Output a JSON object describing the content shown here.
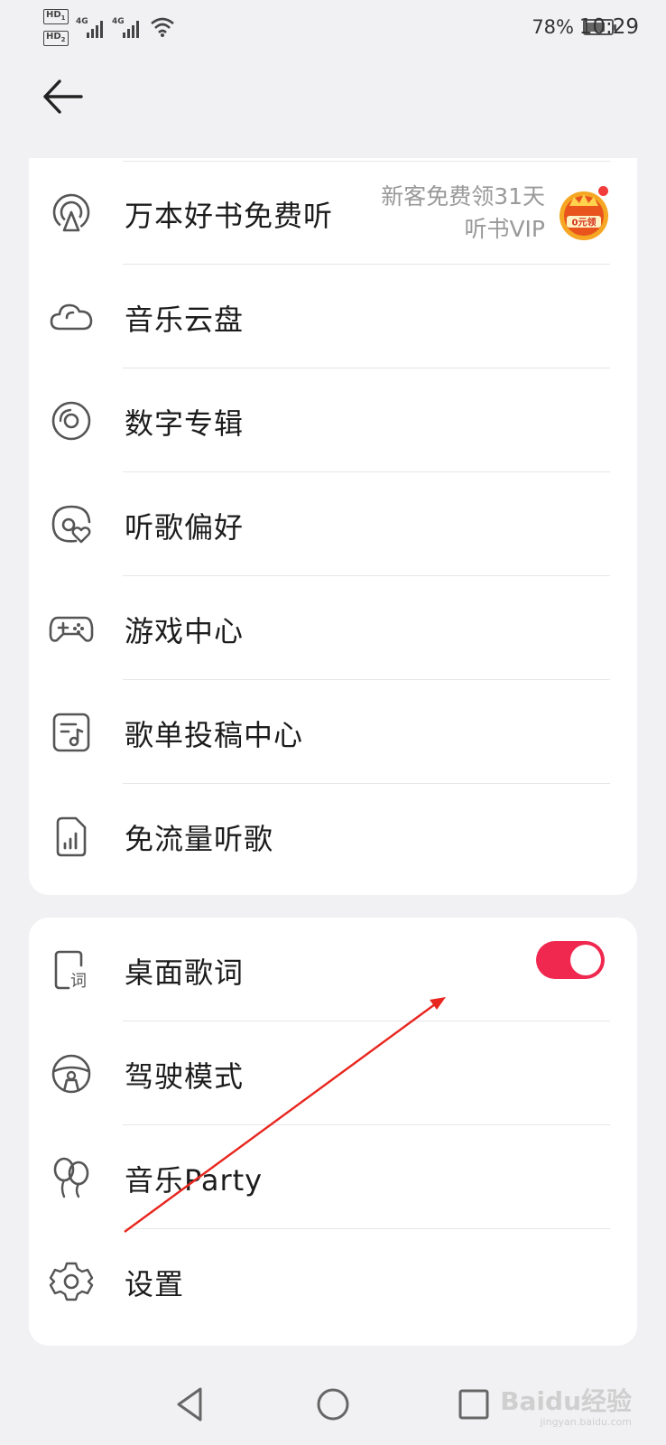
{
  "status_bar": {
    "sim1": "HD",
    "sim1_index": "1",
    "sim2": "HD",
    "sim2_index": "2",
    "network1": "4G",
    "network2": "4G",
    "battery_percent": "78%",
    "battery_level": 0.78,
    "time": "10:29"
  },
  "header": {
    "back_icon": "arrow-left-icon"
  },
  "list1": {
    "items": [
      {
        "label": "万本好书免费听",
        "icon": "audiobook-icon",
        "promo_line1": "新客免费领31天",
        "promo_line2": "听书VIP",
        "badge_text": "0元领"
      },
      {
        "label": "音乐云盘",
        "icon": "cloud-icon"
      },
      {
        "label": "数字专辑",
        "icon": "disc-icon"
      },
      {
        "label": "听歌偏好",
        "icon": "music-preference-icon"
      },
      {
        "label": "游戏中心",
        "icon": "gamepad-icon"
      },
      {
        "label": "歌单投稿中心",
        "icon": "playlist-submit-icon"
      },
      {
        "label": "免流量听歌",
        "icon": "sim-data-icon"
      }
    ]
  },
  "list2": {
    "items": [
      {
        "label": "桌面歌词",
        "icon": "desktop-lyrics-icon",
        "toggle_on": true
      },
      {
        "label": "驾驶模式",
        "icon": "steering-wheel-icon"
      },
      {
        "label": "音乐Party",
        "icon": "balloons-icon"
      },
      {
        "label": "设置",
        "icon": "gear-icon"
      }
    ]
  },
  "colors": {
    "accent": "#f0284f",
    "background": "#f1f1f3",
    "card": "#ffffff",
    "annotation_arrow": "#e8261e"
  },
  "watermark": {
    "brand": "Baidu经验",
    "url": "jingyan.baidu.com"
  }
}
